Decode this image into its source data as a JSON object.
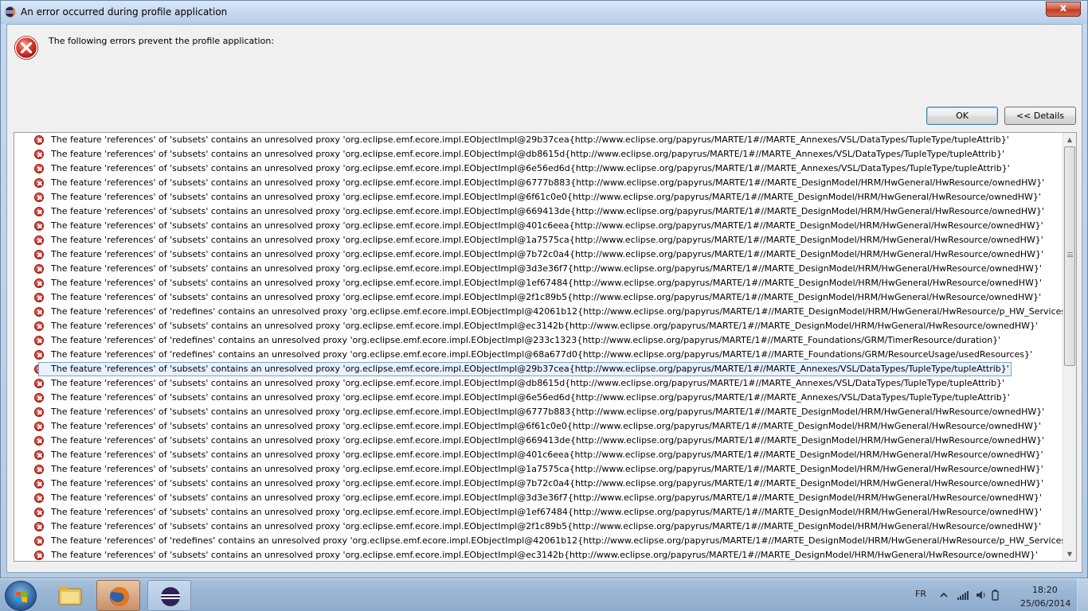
{
  "window": {
    "title": "An error occurred during profile application",
    "close_label": "x"
  },
  "dialog": {
    "message": "The following errors prevent the profile application:",
    "ok_label": "OK",
    "details_label": "<< Details",
    "selected_index": 16,
    "rows": [
      "The feature 'references' of 'subsets' contains an unresolved proxy 'org.eclipse.emf.ecore.impl.EObjectImpl@29b37cea{http://www.eclipse.org/papyrus/MARTE/1#//MARTE_Annexes/VSL/DataTypes/TupleType/tupleAttrib}'",
      "The feature 'references' of 'subsets' contains an unresolved proxy 'org.eclipse.emf.ecore.impl.EObjectImpl@db8615d{http://www.eclipse.org/papyrus/MARTE/1#//MARTE_Annexes/VSL/DataTypes/TupleType/tupleAttrib}'",
      "The feature 'references' of 'subsets' contains an unresolved proxy 'org.eclipse.emf.ecore.impl.EObjectImpl@6e56ed6d{http://www.eclipse.org/papyrus/MARTE/1#//MARTE_Annexes/VSL/DataTypes/TupleType/tupleAttrib}'",
      "The feature 'references' of 'subsets' contains an unresolved proxy 'org.eclipse.emf.ecore.impl.EObjectImpl@6777b883{http://www.eclipse.org/papyrus/MARTE/1#//MARTE_DesignModel/HRM/HwGeneral/HwResource/ownedHW}'",
      "The feature 'references' of 'subsets' contains an unresolved proxy 'org.eclipse.emf.ecore.impl.EObjectImpl@6f61c0e0{http://www.eclipse.org/papyrus/MARTE/1#//MARTE_DesignModel/HRM/HwGeneral/HwResource/ownedHW}'",
      "The feature 'references' of 'subsets' contains an unresolved proxy 'org.eclipse.emf.ecore.impl.EObjectImpl@669413de{http://www.eclipse.org/papyrus/MARTE/1#//MARTE_DesignModel/HRM/HwGeneral/HwResource/ownedHW}'",
      "The feature 'references' of 'subsets' contains an unresolved proxy 'org.eclipse.emf.ecore.impl.EObjectImpl@401c6eea{http://www.eclipse.org/papyrus/MARTE/1#//MARTE_DesignModel/HRM/HwGeneral/HwResource/ownedHW}'",
      "The feature 'references' of 'subsets' contains an unresolved proxy 'org.eclipse.emf.ecore.impl.EObjectImpl@1a7575ca{http://www.eclipse.org/papyrus/MARTE/1#//MARTE_DesignModel/HRM/HwGeneral/HwResource/ownedHW}'",
      "The feature 'references' of 'subsets' contains an unresolved proxy 'org.eclipse.emf.ecore.impl.EObjectImpl@7b72c0a4{http://www.eclipse.org/papyrus/MARTE/1#//MARTE_DesignModel/HRM/HwGeneral/HwResource/ownedHW}'",
      "The feature 'references' of 'subsets' contains an unresolved proxy 'org.eclipse.emf.ecore.impl.EObjectImpl@3d3e36f7{http://www.eclipse.org/papyrus/MARTE/1#//MARTE_DesignModel/HRM/HwGeneral/HwResource/ownedHW}'",
      "The feature 'references' of 'subsets' contains an unresolved proxy 'org.eclipse.emf.ecore.impl.EObjectImpl@1ef67484{http://www.eclipse.org/papyrus/MARTE/1#//MARTE_DesignModel/HRM/HwGeneral/HwResource/ownedHW}'",
      "The feature 'references' of 'subsets' contains an unresolved proxy 'org.eclipse.emf.ecore.impl.EObjectImpl@2f1c89b5{http://www.eclipse.org/papyrus/MARTE/1#//MARTE_DesignModel/HRM/HwGeneral/HwResource/ownedHW}'",
      "The feature 'references' of 'redefines' contains an unresolved proxy 'org.eclipse.emf.ecore.impl.EObjectImpl@42061b12{http://www.eclipse.org/papyrus/MARTE/1#//MARTE_DesignModel/HRM/HwGeneral/HwResource/p_HW_Services}'",
      "The feature 'references' of 'subsets' contains an unresolved proxy 'org.eclipse.emf.ecore.impl.EObjectImpl@ec3142b{http://www.eclipse.org/papyrus/MARTE/1#//MARTE_DesignModel/HRM/HwGeneral/HwResource/ownedHW}'",
      "The feature 'references' of 'redefines' contains an unresolved proxy 'org.eclipse.emf.ecore.impl.EObjectImpl@233c1323{http://www.eclipse.org/papyrus/MARTE/1#//MARTE_Foundations/GRM/TimerResource/duration}'",
      "The feature 'references' of 'redefines' contains an unresolved proxy 'org.eclipse.emf.ecore.impl.EObjectImpl@68a677d0{http://www.eclipse.org/papyrus/MARTE/1#//MARTE_Foundations/GRM/ResourceUsage/usedResources}'",
      "The feature 'references' of 'subsets' contains an unresolved proxy 'org.eclipse.emf.ecore.impl.EObjectImpl@29b37cea{http://www.eclipse.org/papyrus/MARTE/1#//MARTE_Annexes/VSL/DataTypes/TupleType/tupleAttrib}'",
      "The feature 'references' of 'subsets' contains an unresolved proxy 'org.eclipse.emf.ecore.impl.EObjectImpl@db8615d{http://www.eclipse.org/papyrus/MARTE/1#//MARTE_Annexes/VSL/DataTypes/TupleType/tupleAttrib}'",
      "The feature 'references' of 'subsets' contains an unresolved proxy 'org.eclipse.emf.ecore.impl.EObjectImpl@6e56ed6d{http://www.eclipse.org/papyrus/MARTE/1#//MARTE_Annexes/VSL/DataTypes/TupleType/tupleAttrib}'",
      "The feature 'references' of 'subsets' contains an unresolved proxy 'org.eclipse.emf.ecore.impl.EObjectImpl@6777b883{http://www.eclipse.org/papyrus/MARTE/1#//MARTE_DesignModel/HRM/HwGeneral/HwResource/ownedHW}'",
      "The feature 'references' of 'subsets' contains an unresolved proxy 'org.eclipse.emf.ecore.impl.EObjectImpl@6f61c0e0{http://www.eclipse.org/papyrus/MARTE/1#//MARTE_DesignModel/HRM/HwGeneral/HwResource/ownedHW}'",
      "The feature 'references' of 'subsets' contains an unresolved proxy 'org.eclipse.emf.ecore.impl.EObjectImpl@669413de{http://www.eclipse.org/papyrus/MARTE/1#//MARTE_DesignModel/HRM/HwGeneral/HwResource/ownedHW}'",
      "The feature 'references' of 'subsets' contains an unresolved proxy 'org.eclipse.emf.ecore.impl.EObjectImpl@401c6eea{http://www.eclipse.org/papyrus/MARTE/1#//MARTE_DesignModel/HRM/HwGeneral/HwResource/ownedHW}'",
      "The feature 'references' of 'subsets' contains an unresolved proxy 'org.eclipse.emf.ecore.impl.EObjectImpl@1a7575ca{http://www.eclipse.org/papyrus/MARTE/1#//MARTE_DesignModel/HRM/HwGeneral/HwResource/ownedHW}'",
      "The feature 'references' of 'subsets' contains an unresolved proxy 'org.eclipse.emf.ecore.impl.EObjectImpl@7b72c0a4{http://www.eclipse.org/papyrus/MARTE/1#//MARTE_DesignModel/HRM/HwGeneral/HwResource/ownedHW}'",
      "The feature 'references' of 'subsets' contains an unresolved proxy 'org.eclipse.emf.ecore.impl.EObjectImpl@3d3e36f7{http://www.eclipse.org/papyrus/MARTE/1#//MARTE_DesignModel/HRM/HwGeneral/HwResource/ownedHW}'",
      "The feature 'references' of 'subsets' contains an unresolved proxy 'org.eclipse.emf.ecore.impl.EObjectImpl@1ef67484{http://www.eclipse.org/papyrus/MARTE/1#//MARTE_DesignModel/HRM/HwGeneral/HwResource/ownedHW}'",
      "The feature 'references' of 'subsets' contains an unresolved proxy 'org.eclipse.emf.ecore.impl.EObjectImpl@2f1c89b5{http://www.eclipse.org/papyrus/MARTE/1#//MARTE_DesignModel/HRM/HwGeneral/HwResource/ownedHW}'",
      "The feature 'references' of 'redefines' contains an unresolved proxy 'org.eclipse.emf.ecore.impl.EObjectImpl@42061b12{http://www.eclipse.org/papyrus/MARTE/1#//MARTE_DesignModel/HRM/HwGeneral/HwResource/p_HW_Services}'",
      "The feature 'references' of 'subsets' contains an unresolved proxy 'org.eclipse.emf.ecore.impl.EObjectImpl@ec3142b{http://www.eclipse.org/papyrus/MARTE/1#//MARTE_DesignModel/HRM/HwGeneral/HwResource/ownedHW}'"
    ]
  },
  "icons": {
    "dialog": "error-icon",
    "row": "error-small-icon"
  },
  "taskbar": {
    "language": "FR",
    "time": "18:20",
    "date": "25/06/2014",
    "apps": [
      "windows-explorer",
      "firefox",
      "eclipse"
    ]
  },
  "colors": {
    "error_red": "#c7221a",
    "selection_bg": "#e8f2fc",
    "selection_border": "#7da2ce",
    "ok_focus": "#3c7fb1"
  }
}
